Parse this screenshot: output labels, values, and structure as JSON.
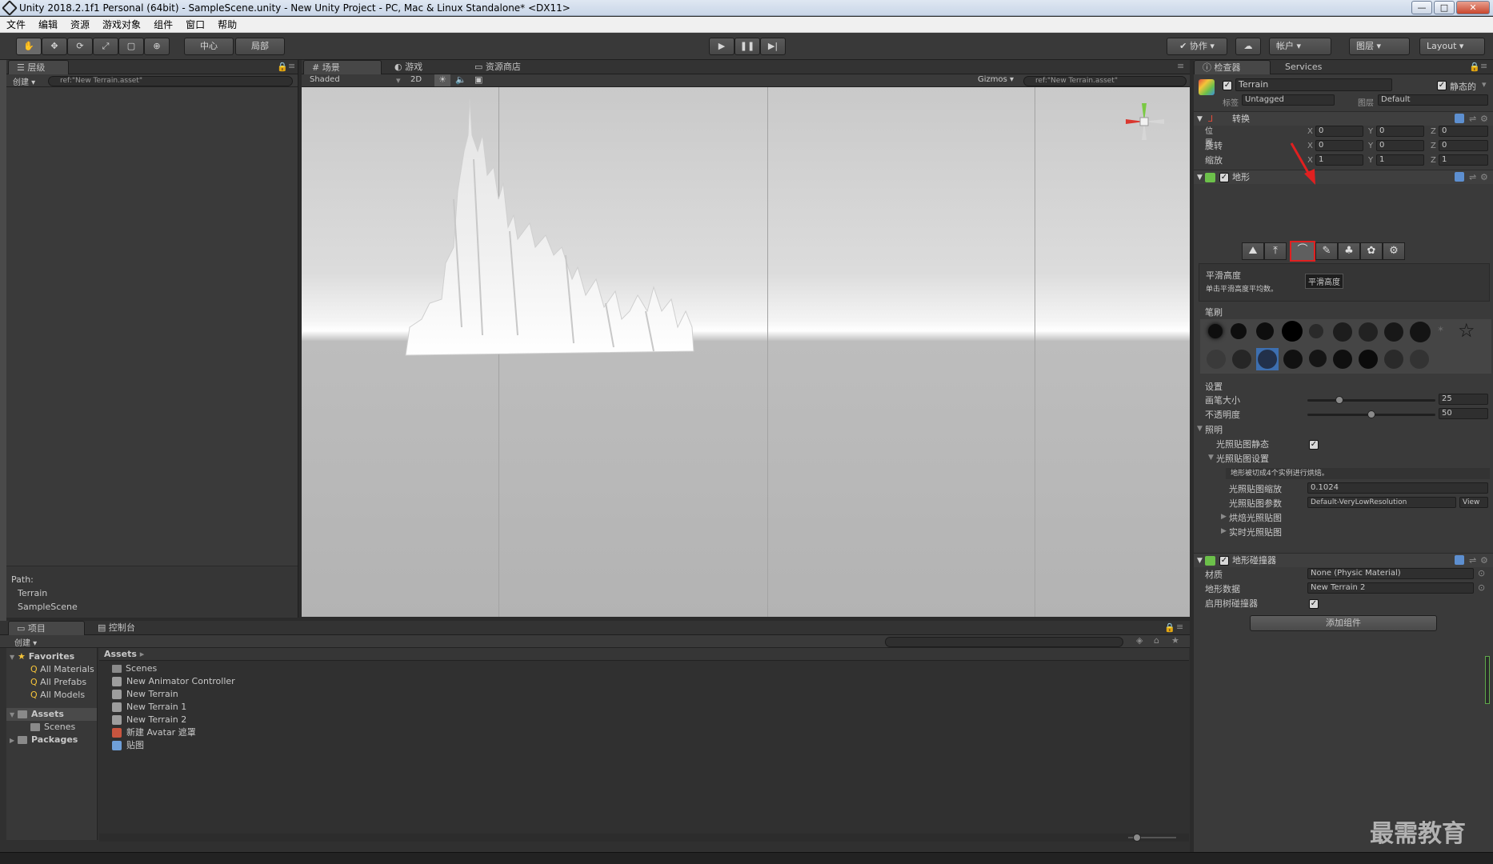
{
  "window": {
    "title": "Unity 2018.2.1f1 Personal (64bit) - SampleScene.unity - New Unity Project - PC, Mac & Linux Standalone* <DX11>"
  },
  "menu": [
    "文件",
    "编辑",
    "资源",
    "游戏对象",
    "组件",
    "窗口",
    "帮助"
  ],
  "toolbar": {
    "pivot": "中心",
    "space": "局部",
    "collab": "协作",
    "account": "帐户",
    "layers": "图层",
    "layout": "Layout"
  },
  "hierarchy": {
    "tab": "层级",
    "create": "创建",
    "search": "ref:\"New Terrain.asset\"",
    "path_label": "Path:",
    "path": [
      "Terrain",
      "SampleScene"
    ]
  },
  "scene": {
    "tabs": [
      "场景",
      "游戏",
      "资源商店"
    ],
    "shading": "Shaded",
    "mode2d": "2D",
    "gizmos": "Gizmos",
    "search": "ref:\"New Terrain.asset\""
  },
  "inspector": {
    "tabs": [
      "检查器",
      "Services"
    ],
    "object_name": "Terrain",
    "static": "静态的",
    "tag_label": "标签",
    "tag": "Untagged",
    "layer_label": "图层",
    "layer": "Default",
    "transform": {
      "title": "转换",
      "rows": [
        {
          "label": "位置",
          "x": "0",
          "y": "0",
          "z": "0"
        },
        {
          "label": "旋转",
          "x": "0",
          "y": "0",
          "z": "0"
        },
        {
          "label": "缩放",
          "x": "1",
          "y": "1",
          "z": "1"
        }
      ]
    },
    "terrain": {
      "title": "地形",
      "tool_title": "平滑高度",
      "tool_hint": "单击平滑高度平均数。",
      "tooltip": "平滑高度",
      "brushes_label": "笔刷",
      "settings_label": "设置",
      "brush_size_label": "画笔大小",
      "brush_size": "25",
      "brush_size_fraction": 0.25,
      "opacity_label": "不透明度",
      "opacity": "50",
      "opacity_fraction": 0.5,
      "lighting_label": "照明",
      "lightmap_static": "光照贴图静态",
      "lightmap_settings": "光照贴图设置",
      "lightmap_warning": "地形被切成4个实例进行烘焙。",
      "lightmap_scale_label": "光照贴图缩放",
      "lightmap_scale": "0.1024",
      "lightmap_params_label": "光照贴图参数",
      "lightmap_params": "Default-VeryLowResolution",
      "view": "View",
      "baked": "烘焙光照贴图",
      "realtime": "实时光照贴图"
    },
    "collider": {
      "title": "地形碰撞器",
      "material_label": "材质",
      "material": "None (Physic Material)",
      "data_label": "地形数据",
      "data": "New Terrain 2",
      "tree_label": "启用树碰撞器"
    },
    "add_component": "添加组件"
  },
  "project": {
    "tabs": [
      "项目",
      "控制台"
    ],
    "create": "创建",
    "favorites": {
      "label": "Favorites",
      "items": [
        "All Materials",
        "All Prefabs",
        "All Models"
      ]
    },
    "tree": [
      {
        "label": "Assets"
      },
      {
        "label": "Scenes"
      },
      {
        "label": "Packages"
      }
    ],
    "breadcrumb": "Assets",
    "assets": [
      "Scenes",
      "New Animator Controller",
      "New Terrain",
      "New Terrain 1",
      "New Terrain 2",
      "新建 Avatar 遮罩",
      "贴图"
    ]
  },
  "watermark": "最需教育",
  "colors": {
    "highlight_red": "#e02020",
    "accent_blue": "#3d6fb0",
    "axis_green": "#7ac943",
    "axis_red": "#d9372f"
  }
}
